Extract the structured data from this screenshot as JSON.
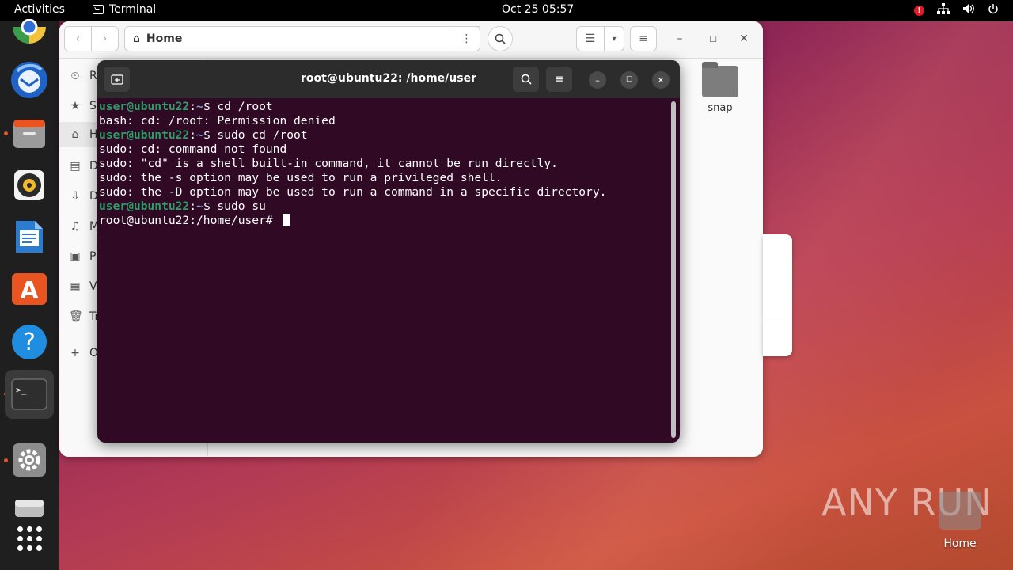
{
  "topbar": {
    "activities": "Activities",
    "app_name": "Terminal",
    "clock": "Oct 25  05:57",
    "alert_badge": "!"
  },
  "dock": {
    "items": [
      {
        "name": "chrome-icon"
      },
      {
        "name": "thunderbird-icon"
      },
      {
        "name": "files-icon"
      },
      {
        "name": "rhythmbox-icon"
      },
      {
        "name": "writer-icon"
      },
      {
        "name": "app-center-icon",
        "glyph": "A"
      },
      {
        "name": "help-icon",
        "glyph": "?"
      },
      {
        "name": "terminal-icon",
        "glyph": ">_"
      },
      {
        "name": "settings-icon"
      },
      {
        "name": "disk-icon"
      },
      {
        "name": "show-apps-icon"
      }
    ]
  },
  "files": {
    "location": "Home",
    "sidebar": [
      {
        "label": "Re",
        "icon": "recent-icon",
        "glyph": "⏲"
      },
      {
        "label": "St",
        "icon": "star-icon",
        "glyph": "★"
      },
      {
        "label": "H",
        "icon": "home-icon",
        "glyph": "⌂"
      },
      {
        "label": "D",
        "icon": "documents-icon",
        "glyph": "▤"
      },
      {
        "label": "D",
        "icon": "downloads-icon",
        "glyph": "⇩"
      },
      {
        "label": "M",
        "icon": "music-icon",
        "glyph": "♫"
      },
      {
        "label": "Pi",
        "icon": "pictures-icon",
        "glyph": "▣"
      },
      {
        "label": "Vi",
        "icon": "videos-icon",
        "glyph": "▦"
      },
      {
        "label": "Tr",
        "icon": "trash-icon",
        "glyph": "🗑"
      },
      {
        "label": "O",
        "icon": "other-locations-icon",
        "glyph": "+"
      }
    ],
    "folders": [
      {
        "label": "snap"
      }
    ]
  },
  "terminal": {
    "title": "root@ubuntu22: /home/user",
    "lines": [
      {
        "user": "user@ubuntu22",
        "path": "~",
        "cmd": "$ cd /root"
      },
      {
        "text": "bash: cd: /root: Permission denied"
      },
      {
        "user": "user@ubuntu22",
        "path": "~",
        "cmd": "$ sudo cd /root"
      },
      {
        "text": "sudo: cd: command not found"
      },
      {
        "text": "sudo: \"cd\" is a shell built-in command, it cannot be run directly."
      },
      {
        "text": "sudo: the -s option may be used to run a privileged shell."
      },
      {
        "text": "sudo: the -D option may be used to run a command in a specific directory."
      },
      {
        "user": "user@ubuntu22",
        "path": "~",
        "cmd": "$ sudo su"
      },
      {
        "text": "root@ubuntu22:/home/user# "
      }
    ]
  },
  "desktop": {
    "home_label": "Home",
    "watermark": "ANY RUN"
  },
  "colors": {
    "prompt_user": "#26a269",
    "prompt_path": "#7a9fd1",
    "terminal_bg": "#300a24",
    "accent": "#e95420"
  }
}
